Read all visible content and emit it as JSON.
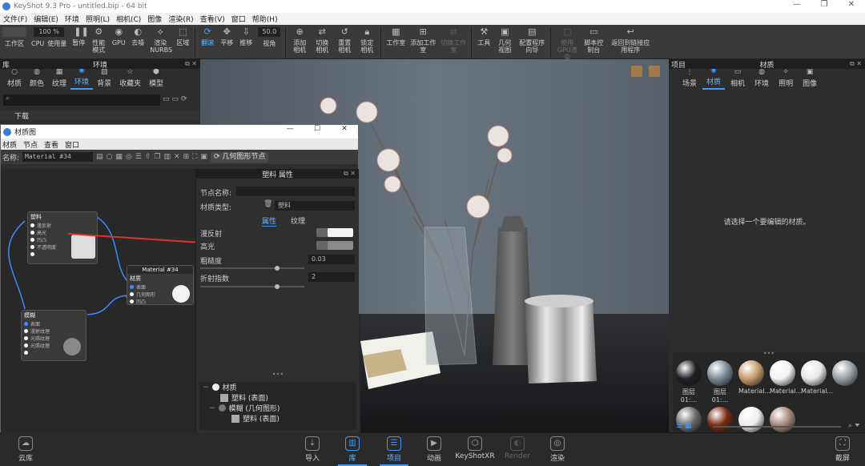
{
  "app": {
    "title": "KeyShot 9.3 Pro - untitled.bip - 64 bit",
    "window_controls": [
      "—",
      "❐",
      "✕"
    ]
  },
  "menu": [
    "文件(F)",
    "编辑(E)",
    "环境",
    "照明(L)",
    "相机(C)",
    "图像",
    "渲染(R)",
    "查看(V)",
    "窗口",
    "帮助(H)"
  ],
  "ribbon": {
    "workarea": "工作区",
    "cpu_usage_value": "100 %",
    "cpu": "CPU",
    "usage": "使用量",
    "pause": "暂停",
    "perf_mode": "性能模式",
    "gpu": "GPU",
    "denoise": "去噪",
    "render_nurbs": "渲染NURBS",
    "region": "区域",
    "refresh": "翻滚",
    "pan": "平移",
    "dolly": "推移",
    "fov_value": "50.0",
    "view": "视角",
    "add_camera": "添加相机",
    "switch_camera": "切换相机",
    "reset_camera": "重置相机",
    "lock_camera": "锁定相机",
    "studio": "工作室",
    "add_studio": "添加工作室",
    "switch_studio": "切换工作室",
    "tools": "工具",
    "geometry_view": "几何视图",
    "config_wizard": "配置程序向导",
    "gpu_render": "使用GPU渲染",
    "script_console": "脚本控制台",
    "back_to_linked": "返回到链接应用程序"
  },
  "library": {
    "panel_title": "库",
    "title": "环境",
    "tabs": [
      "材质",
      "颜色",
      "纹理",
      "环境",
      "背景",
      "收藏夹",
      "模型"
    ],
    "active_tab": 3,
    "search_placeholder": "",
    "folder": "下载"
  },
  "project": {
    "panel_title": "项目",
    "title": "材质",
    "tabs": [
      "场景",
      "材质",
      "相机",
      "环境",
      "照明",
      "图像"
    ],
    "active_tab": 1,
    "message": "请选择一个要编辑的材质。"
  },
  "thumbs": [
    {
      "label": "图层 01:...",
      "color": "#1e2024"
    },
    {
      "label": "图层 01:...",
      "color": "#7a8a96"
    },
    {
      "label": "Material...",
      "color": "#c79a6e"
    },
    {
      "label": "Material...",
      "color": "#f2f2f2"
    },
    {
      "label": "Material...",
      "color": "#e8e8e8"
    },
    {
      "label": "",
      "color": "#9aa0a4"
    },
    {
      "label": "",
      "color": "#6a6a6a"
    },
    {
      "label": "",
      "color": "#7a2a10"
    },
    {
      "label": "",
      "color": "#efefef"
    },
    {
      "label": "",
      "color": "#a88878"
    }
  ],
  "statusbar": {
    "cloud_library": "云库",
    "import": "导入",
    "library": "库",
    "project": "项目",
    "animation": "动画",
    "keyshotxr": "KeyShotXR",
    "render_disabled": "Render",
    "render": "渲染",
    "screenshot": "截屏"
  },
  "material_graph": {
    "title": "材质图",
    "window_controls": [
      "—",
      "☐",
      "✕"
    ],
    "menu": [
      "材质",
      "节点",
      "查看",
      "窗口"
    ],
    "name_label": "名称:",
    "name_value": "Material #34",
    "geo_node_button": "几何图形节点",
    "nodes": {
      "plastic": {
        "title": "塑料",
        "ports": [
          "漫反射",
          "高光",
          "凹凸",
          "不透明度",
          ""
        ]
      },
      "material": {
        "title": "Material #34",
        "sub": "材质",
        "ports": [
          "表面",
          "几何图形",
          "凹凸"
        ]
      },
      "texture": {
        "title": "模糊",
        "ports": [
          "表面",
          "漫射纹理",
          "光照纹理",
          "光照纹理",
          ""
        ]
      }
    },
    "properties": {
      "panel_title": "塑料 属性",
      "node_name_label": "节点名称:",
      "node_name_value": "",
      "material_type_label": "材质类型:",
      "material_type_value": "塑料",
      "tabs": [
        "属性",
        "纹理"
      ],
      "active_tab": 0,
      "diffuse_label": "漫反射",
      "diffuse_color": "#f4f4f4",
      "specular_label": "高光",
      "specular_color": "#8a8a8a",
      "roughness_label": "粗糙度",
      "roughness_value": "0.03",
      "ior_label": "折射指数",
      "ior_value": "2",
      "tree": [
        {
          "label": "材质",
          "depth": 0
        },
        {
          "label": "塑料 (表面)",
          "depth": 1
        },
        {
          "label": "模糊 (几何图形)",
          "depth": 1
        },
        {
          "label": "塑料 (表面)",
          "depth": 2
        }
      ]
    }
  }
}
